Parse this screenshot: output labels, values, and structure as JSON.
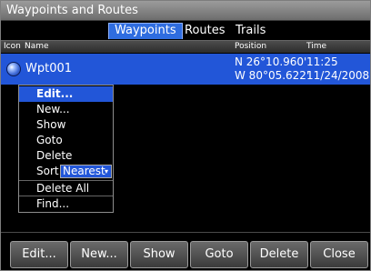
{
  "window": {
    "title": "Waypoints and Routes"
  },
  "tabs": [
    {
      "label": "Waypoints",
      "active": true
    },
    {
      "label": "Routes",
      "active": false
    },
    {
      "label": "Trails",
      "active": false
    }
  ],
  "columns": {
    "icon": "Icon",
    "name": "Name",
    "position": "Position",
    "time": "Time"
  },
  "rows": [
    {
      "icon": "waypoint-icon",
      "name": "Wpt001",
      "lat": "N  26°10.960'",
      "lon": "W  80°05.622'",
      "time": "11:25",
      "date": "11/24/2008"
    }
  ],
  "context_menu": {
    "items": [
      "Edit...",
      "New...",
      "Show",
      "Goto",
      "Delete"
    ],
    "sort_label": "Sort",
    "sort_value": "Nearest",
    "items_after": [
      "Delete All",
      "Find..."
    ]
  },
  "buttons": [
    "Edit...",
    "New...",
    "Show",
    "Goto",
    "Delete",
    "Close"
  ],
  "colors": {
    "selection": "#2256d8",
    "background": "#000000"
  }
}
